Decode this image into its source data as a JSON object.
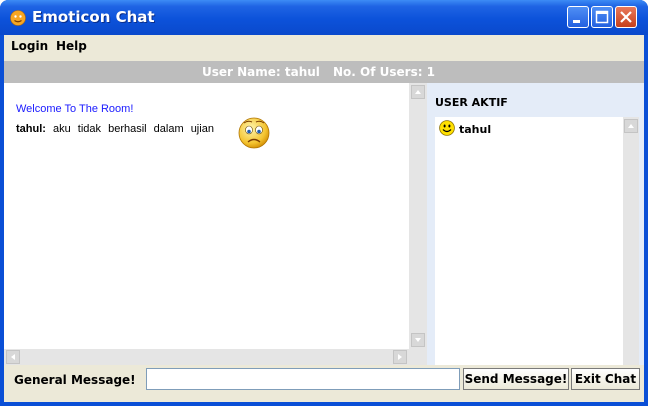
{
  "window": {
    "title": "Emoticon Chat"
  },
  "menu": {
    "items": [
      "Login",
      "Help"
    ]
  },
  "status": {
    "user_name": "User Name: tahul",
    "users_count": "No. Of Users: 1"
  },
  "chat": {
    "welcome": "Welcome To The Room!",
    "messages": [
      {
        "user": "tahul:",
        "text": "aku tidak berhasil dalam ujian",
        "emoticon": "sad-face-icon"
      }
    ]
  },
  "users": {
    "title": "USER AKTIF",
    "list": [
      {
        "name": "tahul",
        "icon": "smiley-icon"
      }
    ]
  },
  "footer": {
    "label": "General Message!",
    "message_value": "",
    "send_label": "Send Message!",
    "exit_label": "Exit Chat"
  },
  "colors": {
    "title_bar": "#0a52da",
    "status_bar": "#bdbdbd",
    "welcome_text": "#1a1aff",
    "users_panel": "#e4ecf8"
  }
}
